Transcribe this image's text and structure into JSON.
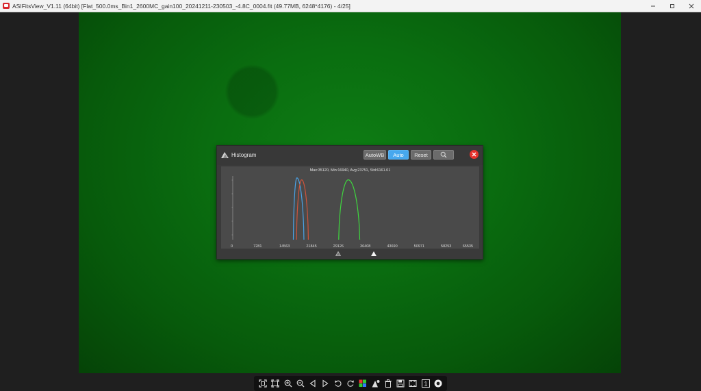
{
  "window": {
    "title": "ASIFitsView_V1.11 (64bit) [Flat_500.0ms_Bin1_2600MC_gain100_20241211-230503_-4.8C_0004.fit (49.77MB, 6248*4176) - 4/25]",
    "controls": [
      "minimize-icon",
      "maximize-icon",
      "close-icon"
    ]
  },
  "histogram": {
    "title": "Histogram",
    "buttons": {
      "autowb": "AutoWB",
      "auto": "Auto",
      "reset": "Reset"
    },
    "stats": "Max:35120, Min:16940, Avg:23751, Std:6161.01",
    "active_button_color": "#47a8ee",
    "chart_data": {
      "type": "line",
      "x_ticks": [
        "0",
        "7281",
        "14563",
        "21845",
        "29126",
        "36408",
        "43690",
        "50971",
        "58253",
        "65535"
      ],
      "xlim": [
        0,
        65535
      ],
      "series": [
        {
          "color": "#4aa3e8",
          "peak_x": 17900,
          "range": [
            16940,
            19800
          ],
          "rel_height": 0.95
        },
        {
          "color": "#d0543c",
          "peak_x": 19200,
          "range": [
            17800,
            21000
          ],
          "rel_height": 0.92
        },
        {
          "color": "#3ed83e",
          "peak_x": 31800,
          "range": [
            29200,
            34900
          ],
          "rel_height": 0.92
        }
      ],
      "black_point": 29126,
      "white_point": 38600
    }
  },
  "toolbar": {
    "icons": [
      "fit-window-icon",
      "actual-size-icon",
      "zoom-in-icon",
      "zoom-out-icon",
      "previous-icon",
      "next-icon",
      "rotate-left-icon",
      "rotate-right-icon",
      "debayer-icon",
      "histogram-icon",
      "delete-icon",
      "save-icon",
      "fullscreen-icon",
      "one-to-one-icon",
      "info-icon"
    ],
    "one_to_one_label": "1"
  }
}
